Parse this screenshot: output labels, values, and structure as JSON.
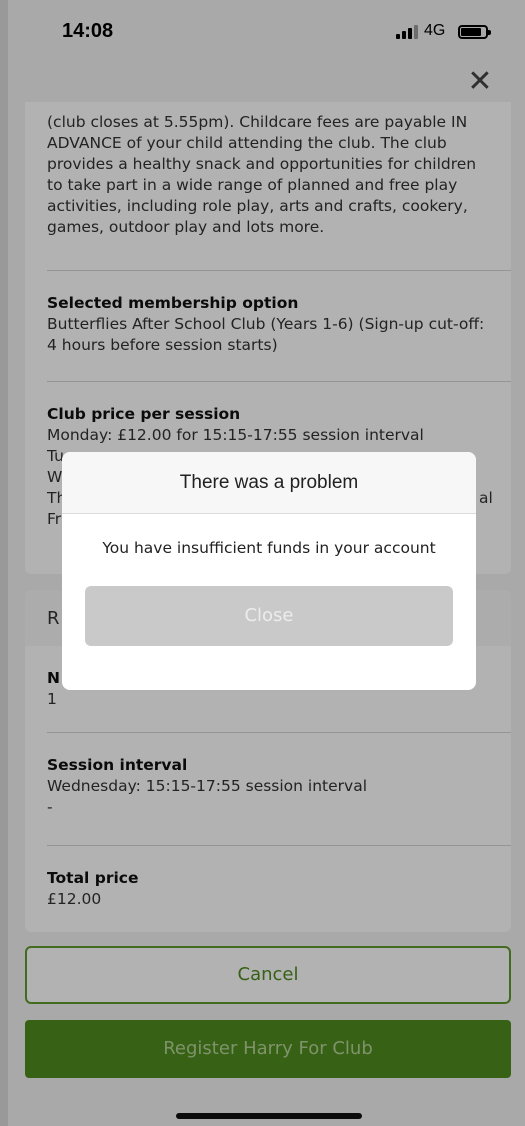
{
  "status_bar": {
    "time": "14:08",
    "network": "4G"
  },
  "close_glyph": "✕",
  "club_info": {
    "description": "(club closes at 5.55pm). Childcare fees are payable IN ADVANCE of your child attending the club. The club provides a healthy snack and opportunities for children to take part in a wide range of planned and free play activities, including role play, arts and crafts, cookery, games, outdoor play and lots more.",
    "membership": {
      "label": "Selected membership option",
      "value": "Butterflies After School Club (Years 1-6) (Sign-up cut-off: 4 hours before session starts)"
    },
    "price": {
      "label": "Club price per session",
      "lines": [
        "Monday: £12.00 for 15:15-17:55 session interval",
        "Tu",
        "W",
        "Th",
        "Fr"
      ],
      "partial_right": "al"
    }
  },
  "registration": {
    "header": "R",
    "number": {
      "label": "N",
      "value": "1"
    },
    "session_interval": {
      "label": "Session interval",
      "value": "Wednesday: 15:15-17:55 session interval",
      "extra": "-"
    },
    "total": {
      "label": "Total price",
      "value": "£12.00"
    }
  },
  "buttons": {
    "cancel": "Cancel",
    "register": "Register Harry For Club"
  },
  "modal": {
    "title": "There was a problem",
    "message": "You have insufficient funds in your account",
    "close": "Close"
  },
  "colors": {
    "brand_green": "#4f8c1e",
    "modal_button_gray": "#c9c9c9"
  }
}
